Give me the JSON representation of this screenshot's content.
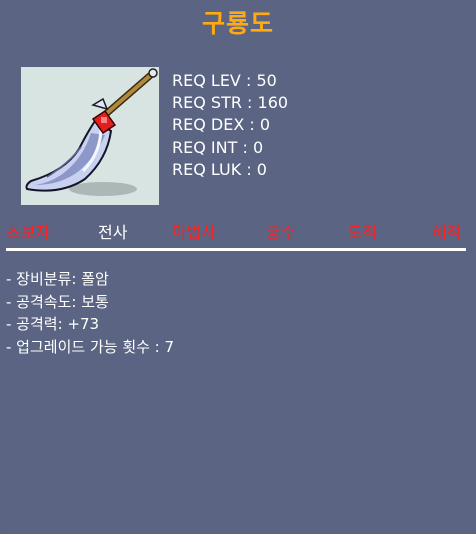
{
  "item": {
    "name": "구룡도"
  },
  "requirements": [
    {
      "label": "REQ LEV",
      "value": "50"
    },
    {
      "label": "REQ STR",
      "value": "160"
    },
    {
      "label": "REQ DEX",
      "value": "0"
    },
    {
      "label": "REQ INT",
      "value": "0"
    },
    {
      "label": "REQ LUK",
      "value": "0"
    }
  ],
  "jobs": [
    {
      "name": "초보자",
      "color": "#ff1f1f"
    },
    {
      "name": "전사",
      "color": "#ffffff"
    },
    {
      "name": "마법사",
      "color": "#ff1f1f"
    },
    {
      "name": "궁수",
      "color": "#ff1f1f"
    },
    {
      "name": "도적",
      "color": "#ff1f1f"
    },
    {
      "name": "해적",
      "color": "#ff1f1f"
    }
  ],
  "description": [
    "- 장비분류: 폴암",
    "- 공격속도: 보통",
    "- 공격력: +73",
    "- 업그레이드 가능 횟수 : 7"
  ],
  "colors": {
    "background": "#5b6583",
    "title": "#ffaa11",
    "icon_background": "#d8e4e2",
    "text": "#ffffff",
    "unavailable_job": "#ff1f1f"
  }
}
